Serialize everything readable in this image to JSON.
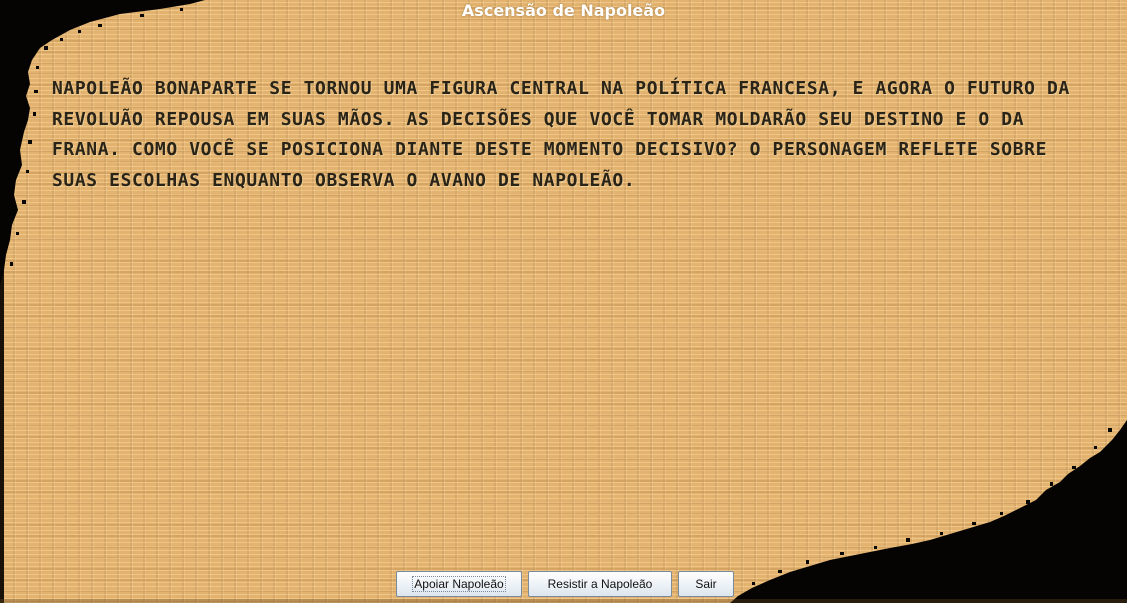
{
  "window": {
    "title": "Ascensão de Napoleão"
  },
  "story": {
    "text": "NAPOLEÃO BONAPARTE SE TORNOU UMA FIGURA CENTRAL NA POLÍTICA FRANCESA, E AGORA O FUTURO DA REVOLUÃO REPOUSA EM SUAS MÃOS. AS DECISÕES QUE VOCÊ TOMAR MOLDARÃO SEU DESTINO E O DA FRANA. COMO VOCÊ SE POSICIONA DIANTE DESTE MOMENTO DECISIVO? O PERSONAGEM REFLETE SOBRE SUAS ESCOLHAS ENQUANTO OBSERVA O AVANO DE NAPOLEÃO."
  },
  "choices": {
    "support_label": "Apoiar Napoleão",
    "resist_label": "Resistir a Napoleão",
    "exit_label": "Sair"
  },
  "colors": {
    "parchment": "#e3b26e",
    "burned_edge": "#000000",
    "story_text": "#2a2418",
    "title_text": "#ffffff"
  }
}
